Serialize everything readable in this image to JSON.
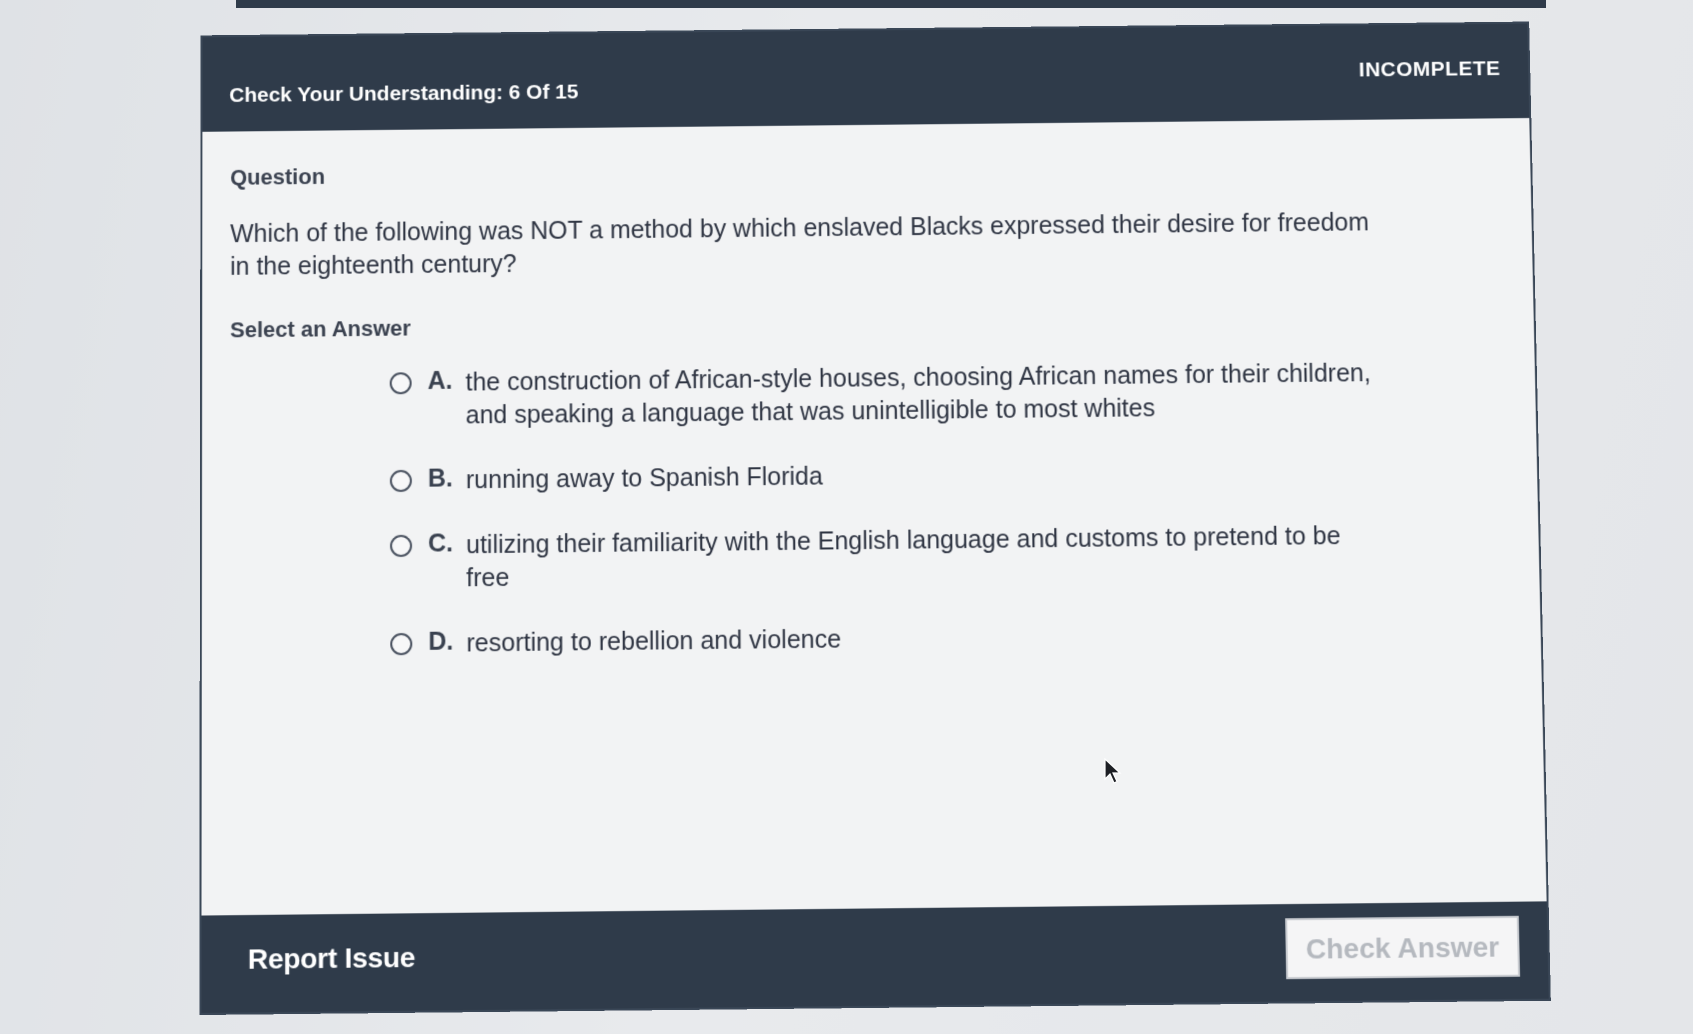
{
  "header": {
    "title": "Check Your Understanding: 6 Of 15",
    "status": "INCOMPLETE"
  },
  "question": {
    "label": "Question",
    "text": "Which of the following was NOT a method by which enslaved Blacks expressed their desire for freedom in the eighteenth century?"
  },
  "answers": {
    "label": "Select an Answer",
    "options": [
      {
        "letter": "A.",
        "text": "the construction of African-style houses, choosing African names for their children, and speaking a language that was unintelligible to most whites"
      },
      {
        "letter": "B.",
        "text": "running away to Spanish Florida"
      },
      {
        "letter": "C.",
        "text": "utilizing their familiarity with the English language and customs to pretend to be free"
      },
      {
        "letter": "D.",
        "text": "resorting to rebellion and violence"
      }
    ]
  },
  "footer": {
    "report_label": "Report Issue",
    "check_label": "Check Answer"
  },
  "colors": {
    "header_bg": "#2f3b4a",
    "panel_bg": "#f2f3f4",
    "check_button_text": "#b5b9bf"
  },
  "icons": {
    "cursor": "mouse-pointer-icon",
    "radio": "radio-unselected-icon"
  }
}
